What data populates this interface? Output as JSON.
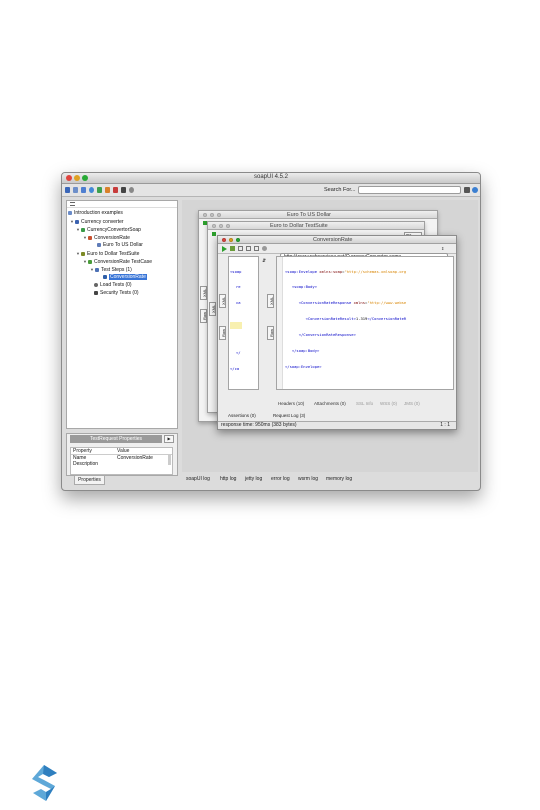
{
  "window": {
    "title": "soapUI 4.5.2"
  },
  "toolbar": {
    "search_label": "Search For..."
  },
  "navigator": {
    "items": [
      {
        "label": "Introduction examples",
        "icon": "project-set-icon"
      },
      {
        "label": "Currency converter",
        "icon": "project-icon"
      },
      {
        "label": "CurrencyConvertorSoap",
        "icon": "interface-icon"
      },
      {
        "label": "ConversionRate",
        "icon": "operation-icon"
      },
      {
        "label": "Euro To US Dollar",
        "icon": "request-icon"
      },
      {
        "label": "Euro to Dollar TestSuite",
        "icon": "testsuite-icon"
      },
      {
        "label": "ConversionRate TestCase",
        "icon": "testcase-icon"
      },
      {
        "label": "Test Steps (1)",
        "icon": "teststeps-icon"
      },
      {
        "label": "ConversionRate",
        "icon": "teststep-icon"
      },
      {
        "label": "Load Tests (0)",
        "icon": "loadtest-icon"
      },
      {
        "label": "Security Tests (0)",
        "icon": "securitytest-icon"
      }
    ]
  },
  "properties": {
    "title": "TestRequest Properties",
    "columns": [
      "Property",
      "Value"
    ],
    "rows": [
      {
        "property": "Name",
        "value": "ConversionRate"
      },
      {
        "property": "Description",
        "value": ""
      }
    ],
    "tab_label": "Properties"
  },
  "logs": [
    "soapUI log",
    "http log",
    "jetty log",
    "error log",
    "wsrm log",
    "memory log"
  ],
  "editors": {
    "back1_title": "Euro To US Dollar",
    "back2_title": "Euro to Dollar TestSuite",
    "front_title": "ConversionRate",
    "endpoint": "http://www.webservicex.net/CurrencyConvertor.asmx",
    "left_pane_lines": [
      "<soap",
      "re",
      "ca",
      "</",
      "</ca"
    ],
    "response_lines": [
      "<soap:Envelope xmlns:soap=\"http://schemas.xmlsoap.org",
      "   <soap:Body>",
      "      <ConversionRateResponse xmlns=\"http://www.webse",
      "         <ConversionRateResult>1.319</ConversionRateR",
      "      </ConversionRateResponse>",
      "   </soap:Body>",
      "</soap:Envelope>"
    ],
    "vtab_raw": "Raw",
    "vtab_xml": "XML",
    "response_tabs": [
      "Headers (10)",
      "Attachments (0)",
      "SSL Info",
      "WSS (0)",
      "JMS (0)"
    ],
    "request_tabs": [
      "Assertions (0)",
      "Request Log (3)"
    ],
    "status_text": "response time: 950ms (383 bytes)",
    "cursor_pos": "1 : 1",
    "back_combo": "mx"
  },
  "colors": {
    "accent": "#3875d7",
    "xml_tag": "#0000c8",
    "xml_value": "#d88400"
  }
}
